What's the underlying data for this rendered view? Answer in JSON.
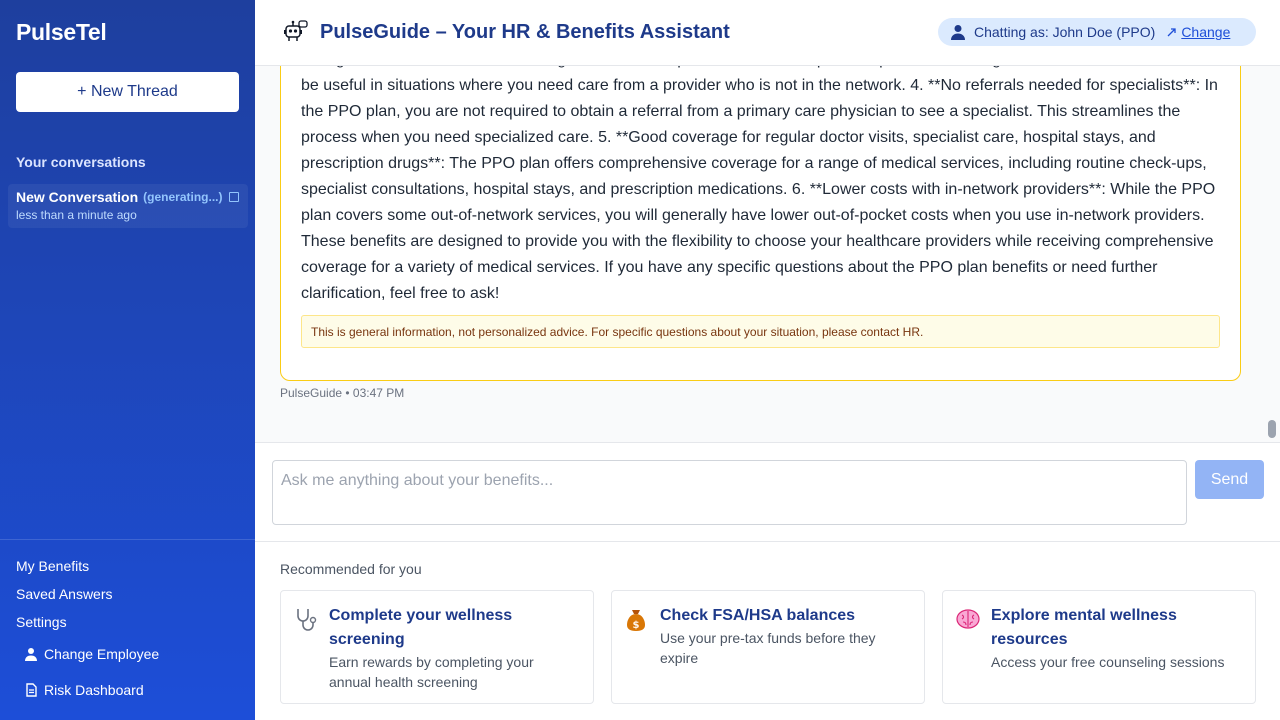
{
  "sidebar": {
    "brand": "PulseTel",
    "new_thread": "+ New Thread",
    "section_label": "Your conversations",
    "conversation": {
      "title": "New Conversation",
      "status": "(generating...)",
      "time": "less than a minute ago"
    },
    "links": {
      "my_benefits": "My Benefits",
      "saved_answers": "Saved Answers",
      "settings": "Settings",
      "change_employee": "Change Employee",
      "risk_dashboard": "Risk Dashboard"
    }
  },
  "header": {
    "title": "PulseGuide – Your HR & Benefits Assistant",
    "chatting_as": "Chatting as: John Doe (PPO)",
    "change": "Change"
  },
  "chat": {
    "message_text": "be higher costs associated with using out-of-network providers, the PPO plan still provides coverage for these services. This can be useful in situations where you need care from a provider who is not in the network. 4. **No referrals needed for specialists**: In the PPO plan, you are not required to obtain a referral from a primary care physician to see a specialist. This streamlines the process when you need specialized care. 5. **Good coverage for regular doctor visits, specialist care, hospital stays, and prescription drugs**: The PPO plan offers comprehensive coverage for a range of medical services, including routine check-ups, specialist consultations, hospital stays, and prescription medications. 6. **Lower costs with in-network providers**: While the PPO plan covers some out-of-network services, you will generally have lower out-of-pocket costs when you use in-network providers. These benefits are designed to provide you with the flexibility to choose your healthcare providers while receiving comprehensive coverage for a variety of medical services. If you have any specific questions about the PPO plan benefits or need further clarification, feel free to ask!",
    "disclaimer": "This is general information, not personalized advice. For specific questions about your situation, please contact HR.",
    "meta": "PulseGuide • 03:47 PM"
  },
  "input": {
    "placeholder": "Ask me anything about your benefits...",
    "value": "",
    "send": "Send"
  },
  "recommendations": {
    "label": "Recommended for you",
    "cards": [
      {
        "icon": "stethoscope-icon",
        "title": "Complete your wellness screening",
        "description": "Earn rewards by completing your annual health screening"
      },
      {
        "icon": "money-bag-icon",
        "title": "Check FSA/HSA balances",
        "description": "Use your pre-tax funds before they expire"
      },
      {
        "icon": "brain-icon",
        "title": "Explore mental wellness resources",
        "description": "Access your free counseling sessions"
      }
    ]
  }
}
